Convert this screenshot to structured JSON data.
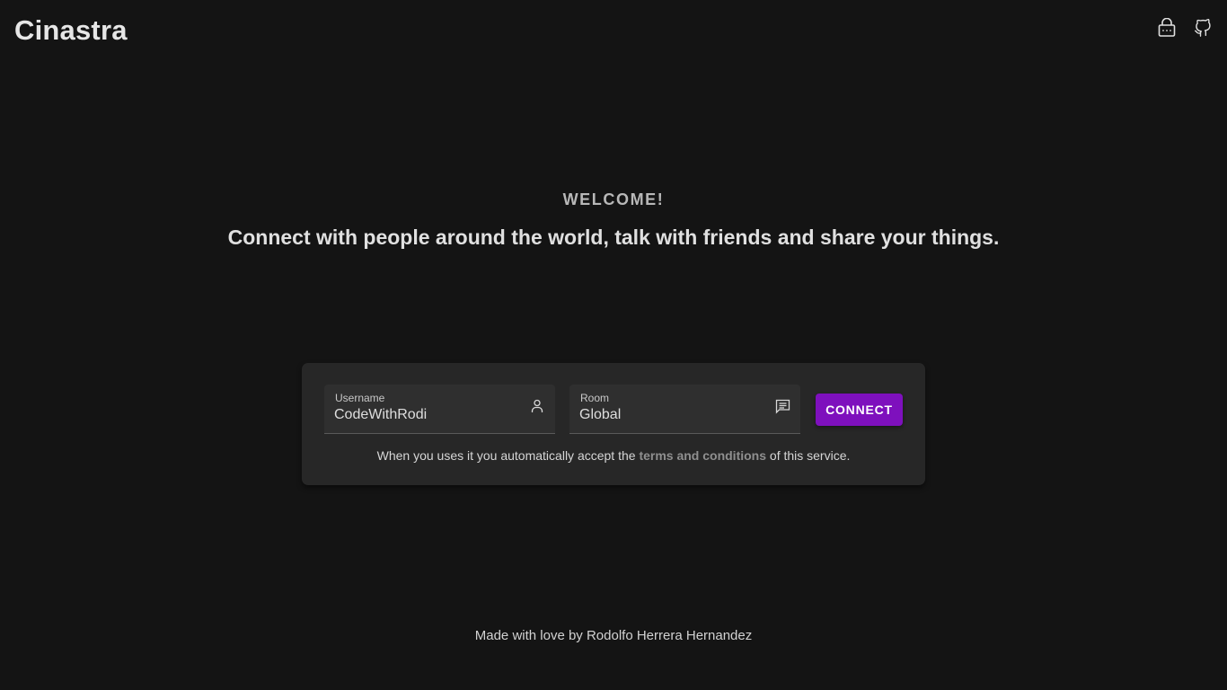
{
  "header": {
    "brand": "Cinastra",
    "actions": [
      {
        "icon": "lock-keyboard-icon"
      },
      {
        "icon": "github-icon"
      }
    ]
  },
  "hero": {
    "welcome": "WELCOME!",
    "tagline": "Connect with people around the world, talk with friends and share your things."
  },
  "form": {
    "username": {
      "label": "Username",
      "value": "CodeWithRodi",
      "icon": "user-icon"
    },
    "room": {
      "label": "Room",
      "value": "Global",
      "icon": "chat-icon"
    },
    "connect_label": "CONNECT",
    "terms_prefix": "When you uses it you automatically accept the",
    "terms_link": "terms and conditions",
    "terms_suffix": "of this service."
  },
  "footer": {
    "text": "Made with love by Rodolfo Herrera Hernandez"
  },
  "colors": {
    "background": "#141414",
    "card": "#272727",
    "accent": "#7e10bd"
  }
}
